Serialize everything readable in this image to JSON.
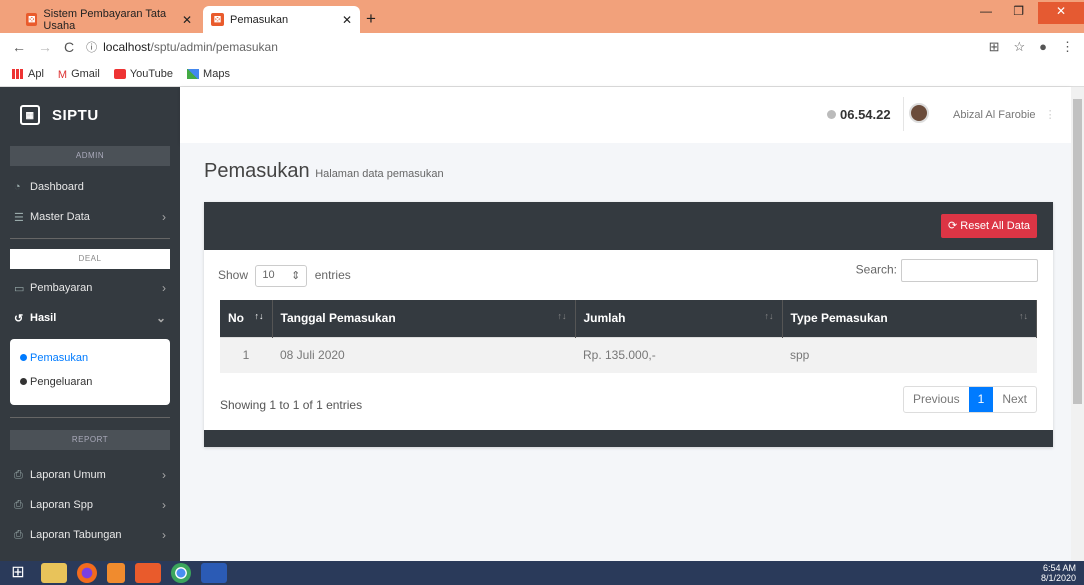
{
  "browser": {
    "tabs": [
      {
        "label": "Sistem Pembayaran Tata Usaha",
        "close": "✕"
      },
      {
        "label": "Pemasukan",
        "close": "✕"
      }
    ],
    "new_tab": "+",
    "url_host": "localhost",
    "url_path": "/sptu/admin/pemasukan",
    "bookmarks": [
      "Apl",
      "Gmail",
      "YouTube",
      "Maps"
    ]
  },
  "sidebar": {
    "brand": "SIPTU",
    "section_admin": "ADMIN",
    "dashboard": "Dashboard",
    "master_data": "Master Data",
    "section_deal": "DEAL",
    "pembayaran": "Pembayaran",
    "hasil": "Hasil",
    "sub_items": [
      "Pemasukan",
      "Pengeluaran"
    ],
    "section_report": "REPORT",
    "reports": [
      "Laporan Umum",
      "Laporan Spp",
      "Laporan Tabungan"
    ]
  },
  "topbar": {
    "time": "06.54.22",
    "user": "Abizal Al Farobie"
  },
  "page": {
    "title": "Pemasukan",
    "subtitle": "Halaman data pemasukan",
    "reset_button": "Reset All Data",
    "show_label": "Show",
    "entries_value": "10",
    "entries_label": "entries",
    "search_label": "Search:",
    "columns": [
      "No",
      "Tanggal Pemasukan",
      "Jumlah",
      "Type Pemasukan"
    ],
    "rows": [
      [
        "1",
        "08 Juli 2020",
        "Rp. 135.000,-",
        "spp"
      ]
    ],
    "info": "Showing 1 to 1 of 1 entries",
    "prev": "Previous",
    "page_num": "1",
    "next": "Next"
  },
  "taskbar": {
    "clock_time": "6:54 AM",
    "clock_date": "8/1/2020"
  }
}
